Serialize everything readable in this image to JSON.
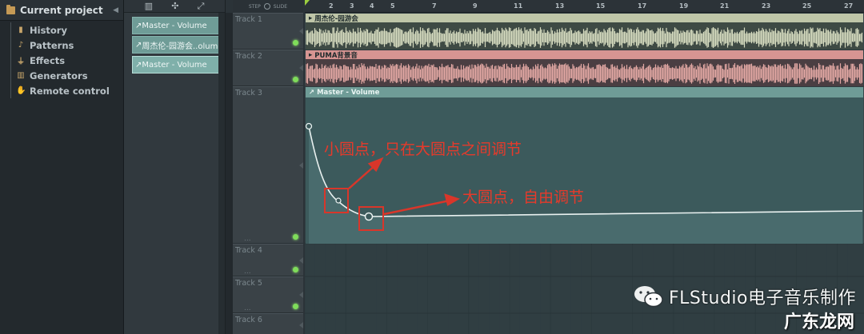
{
  "browser": {
    "title": "Current project",
    "items": [
      {
        "label": "History",
        "icon": "history-icon"
      },
      {
        "label": "Patterns",
        "icon": "note-icon"
      },
      {
        "label": "Effects",
        "icon": "plug-icon"
      },
      {
        "label": "Generators",
        "icon": "keyboard-icon"
      },
      {
        "label": "Remote control",
        "icon": "hand-icon"
      }
    ]
  },
  "clip_source": {
    "items": [
      {
        "label": "Master - Volume"
      },
      {
        "label": "周杰伦-园游会..olume"
      },
      {
        "label": "Master - Volume"
      }
    ]
  },
  "stepbar": {
    "step": "STEP",
    "slide": "SLIDE"
  },
  "ruler": {
    "bars": [
      "2",
      "3",
      "4",
      "5",
      "7",
      "9",
      "11",
      "13",
      "15",
      "17",
      "19",
      "21",
      "23",
      "25",
      "27"
    ]
  },
  "tracks": [
    {
      "name": "Track 1"
    },
    {
      "name": "Track 2"
    },
    {
      "name": "Track 3"
    },
    {
      "name": "Track 4"
    },
    {
      "name": "Track 5"
    },
    {
      "name": "Track 6"
    }
  ],
  "clips": {
    "audio1": "周杰伦-园游会",
    "audio2": "PUMA背景音",
    "automation": "Master - Volume"
  },
  "annotations": {
    "small_point": "小圆点，只在大圆点之间调节",
    "big_point": "大圆点，自由调节"
  },
  "watermark": {
    "text": "FLStudio电子音乐制作",
    "site": "广东龙网"
  },
  "colors": {
    "audio1_wave": "#d7dcc0",
    "audio2_wave": "#e3a8a4",
    "automation": "#6f9c97",
    "annotation": "#e63a2b"
  }
}
